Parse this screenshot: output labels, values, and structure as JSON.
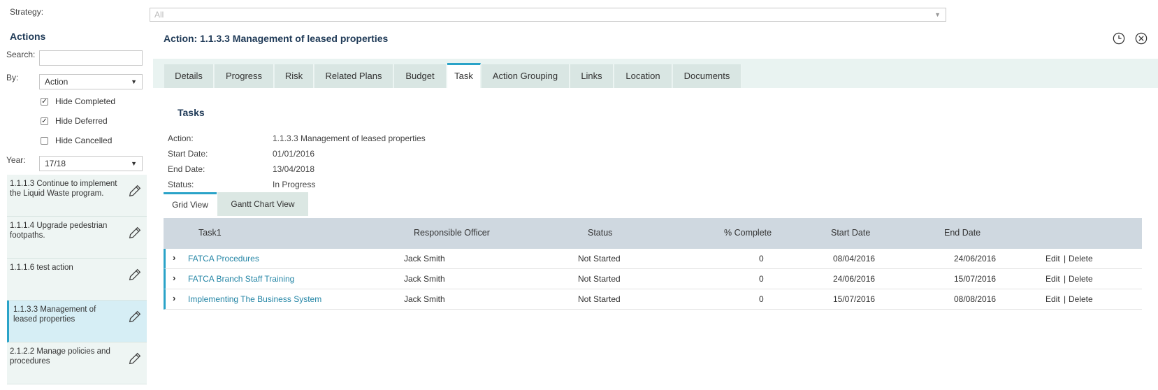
{
  "strategy": {
    "label": "Strategy:",
    "value": "All"
  },
  "sidebar": {
    "title": "Actions",
    "search_label": "Search:",
    "search_value": "",
    "by_label": "By:",
    "by_value": "Action",
    "hide_completed": {
      "label": "Hide Completed",
      "checked": true
    },
    "hide_deferred": {
      "label": "Hide Deferred",
      "checked": true
    },
    "hide_cancelled": {
      "label": "Hide Cancelled",
      "checked": false
    },
    "year_label": "Year:",
    "year_value": "17/18",
    "items": [
      {
        "label": "1.1.1.3 Continue to implement the Liquid Waste program.",
        "selected": false
      },
      {
        "label": "1.1.1.4 Upgrade pedestrian footpaths.",
        "selected": false
      },
      {
        "label": "1.1.1.6 test action",
        "selected": false
      },
      {
        "label": "1.1.3.3 Management of leased properties",
        "selected": true
      },
      {
        "label": "2.1.2.2 Manage policies and procedures",
        "selected": false
      }
    ]
  },
  "main": {
    "title": "Action: 1.1.3.3 Management of leased properties",
    "tabs": [
      "Details",
      "Progress",
      "Risk",
      "Related Plans",
      "Budget",
      "Task",
      "Action Grouping",
      "Links",
      "Location",
      "Documents"
    ],
    "active_tab": "Task",
    "tasks_heading": "Tasks",
    "info": {
      "action_label": "Action:",
      "action_value": "1.1.3.3 Management of leased properties",
      "start_label": "Start Date:",
      "start_value": "01/01/2016",
      "end_label": "End Date:",
      "end_value": "13/04/2018",
      "status_label": "Status:",
      "status_value": "In Progress"
    },
    "view_tabs": [
      "Grid View",
      "Gantt Chart View"
    ],
    "grid": {
      "columns": [
        "Task1",
        "Responsible Officer",
        "Status",
        "% Complete",
        "Start Date",
        "End Date"
      ],
      "rows": [
        {
          "task": "FATCA Procedures",
          "officer": "Jack Smith",
          "status": "Not Started",
          "complete": "0",
          "start": "08/04/2016",
          "end": "24/06/2016",
          "edit": "Edit",
          "sep": "|",
          "delete": "Delete"
        },
        {
          "task": "FATCA Branch Staff Training",
          "officer": "Jack Smith",
          "status": "Not Started",
          "complete": "0",
          "start": "24/06/2016",
          "end": "15/07/2016",
          "edit": "Edit",
          "sep": "|",
          "delete": "Delete"
        },
        {
          "task": "Implementing The Business System",
          "officer": "Jack Smith",
          "status": "Not Started",
          "complete": "0",
          "start": "15/07/2016",
          "end": "08/08/2016",
          "edit": "Edit",
          "sep": "|",
          "delete": "Delete"
        }
      ]
    }
  },
  "icons": {
    "history": "history-icon",
    "close": "close-icon",
    "edit": "pencil-icon"
  },
  "colors": {
    "accent": "#2aa3c8",
    "title": "#1f3a57",
    "link": "#2586a6"
  }
}
